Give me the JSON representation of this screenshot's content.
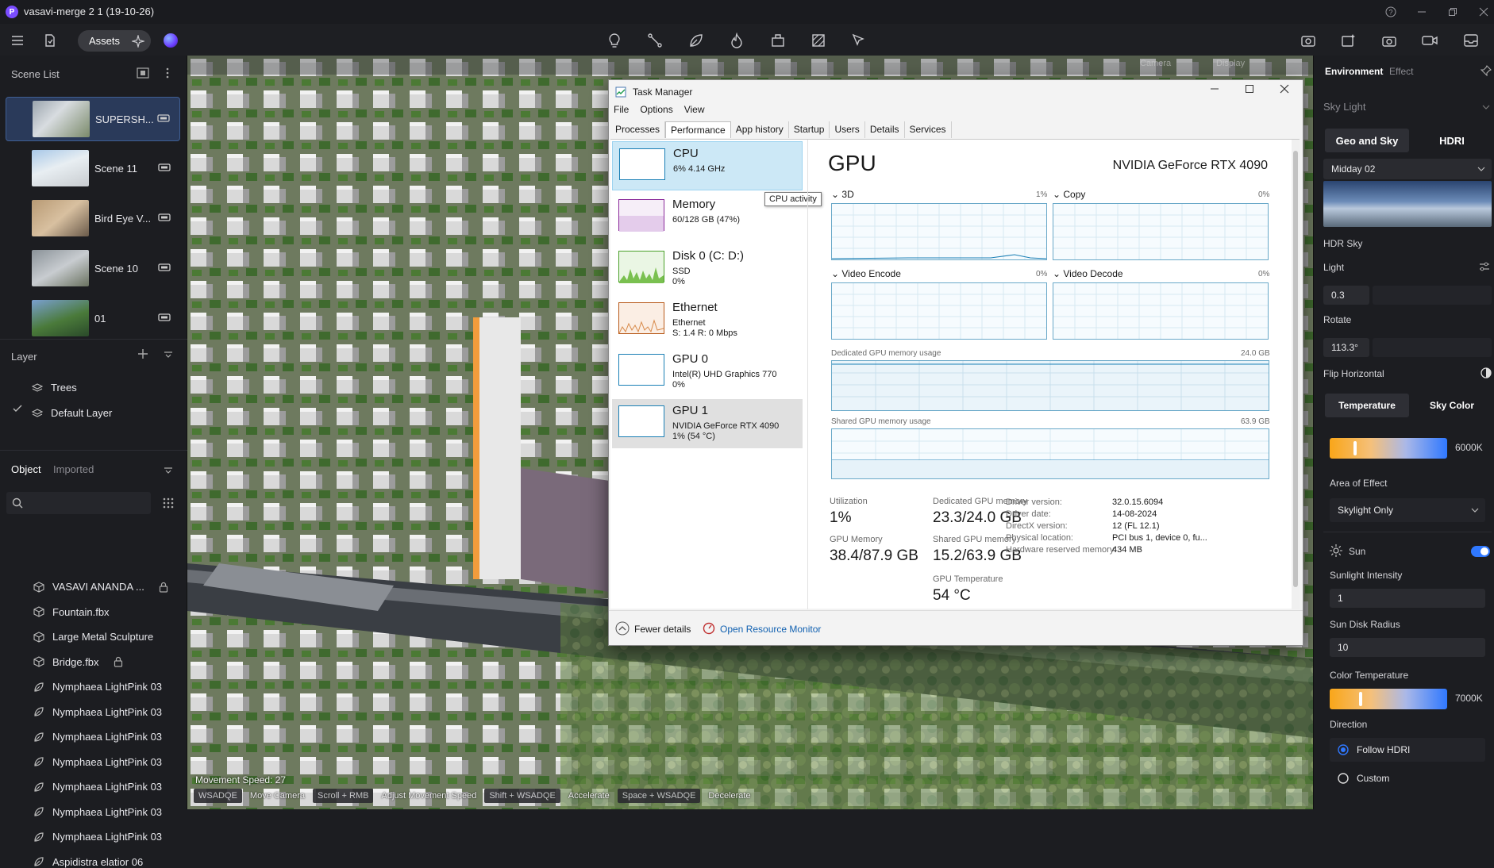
{
  "window": {
    "title": "vasavi-merge 2 1 (19-10-26)",
    "logo_letter": "P"
  },
  "toolbar": {
    "assets_label": "Assets"
  },
  "scene_list": {
    "title": "Scene List",
    "items": [
      {
        "name": "SUPERSH..."
      },
      {
        "name": "Scene 11"
      },
      {
        "name": "Bird Eye V..."
      },
      {
        "name": "Scene 10"
      },
      {
        "name": "01"
      }
    ]
  },
  "layer": {
    "title": "Layer",
    "items": [
      {
        "name": "Trees"
      },
      {
        "name": "Default Layer"
      }
    ]
  },
  "objects": {
    "tab_object": "Object",
    "tab_imported": "Imported",
    "items": [
      {
        "name": "VASAVI ANANDA ...",
        "locked": true
      },
      {
        "name": "Fountain.fbx"
      },
      {
        "name": "Large Metal Sculpture"
      },
      {
        "name": "Bridge.fbx",
        "locked": true
      },
      {
        "name": "Nymphaea LightPink 03"
      },
      {
        "name": "Nymphaea LightPink 03"
      },
      {
        "name": "Nymphaea LightPink 03"
      },
      {
        "name": "Nymphaea LightPink 03"
      },
      {
        "name": "Nymphaea LightPink 03"
      },
      {
        "name": "Nymphaea LightPink 03"
      },
      {
        "name": "Nymphaea LightPink 03"
      },
      {
        "name": "Aspidistra elatior 06"
      }
    ]
  },
  "viewport": {
    "overlay_camera": "Camera",
    "overlay_display": "Display",
    "movement_speed": "Movement Speed: 27",
    "hints": [
      {
        "key": "WSADQE",
        "desc": "Move Camera"
      },
      {
        "key": "Scroll + RMB",
        "desc": "Adjust Movement Speed"
      },
      {
        "key": "Shift + WSADQE",
        "desc": "Accelerate"
      },
      {
        "key": "Space + WSADQE",
        "desc": "Decelerate"
      }
    ]
  },
  "task_manager": {
    "title": "Task Manager",
    "menu": [
      "File",
      "Options",
      "View"
    ],
    "tabs": [
      "Processes",
      "Performance",
      "App history",
      "Startup",
      "Users",
      "Details",
      "Services"
    ],
    "active_tab": "Performance",
    "tooltip": "CPU activity",
    "resources": [
      {
        "name": "CPU",
        "sub1": "6% 4.14 GHz",
        "sub2": "",
        "sub3": ""
      },
      {
        "name": "Memory",
        "sub1": "60/128 GB (47%)",
        "sub2": "",
        "sub3": ""
      },
      {
        "name": "Disk 0 (C: D:)",
        "sub1": "SSD",
        "sub2": "0%",
        "sub3": ""
      },
      {
        "name": "Ethernet",
        "sub1": "Ethernet",
        "sub2": "S: 1.4 R: 0 Mbps",
        "sub3": ""
      },
      {
        "name": "GPU 0",
        "sub1": "Intel(R) UHD Graphics 770",
        "sub2": "0%",
        "sub3": ""
      },
      {
        "name": "GPU 1",
        "sub1": "NVIDIA GeForce RTX 4090",
        "sub2": "1% (54 °C)",
        "sub3": ""
      }
    ],
    "gpu": {
      "heading": "GPU",
      "model": "NVIDIA GeForce RTX 4090",
      "engines": [
        {
          "name": "3D",
          "pct": "1%"
        },
        {
          "name": "Copy",
          "pct": "0%"
        },
        {
          "name": "Video Encode",
          "pct": "0%"
        },
        {
          "name": "Video Decode",
          "pct": "0%"
        }
      ],
      "dedicated_label": "Dedicated GPU memory usage",
      "dedicated_max": "24.0 GB",
      "shared_label": "Shared GPU memory usage",
      "shared_max": "63.9 GB",
      "stats": {
        "utilization_label": "Utilization",
        "utilization": "1%",
        "gpu_memory_label": "GPU Memory",
        "gpu_memory": "38.4/87.9 GB",
        "dedicated_label": "Dedicated GPU memory",
        "dedicated": "23.3/24.0 GB",
        "shared_label": "Shared GPU memory",
        "shared": "15.2/63.9 GB",
        "temp_label": "GPU Temperature",
        "temp": "54 °C"
      },
      "driver": [
        {
          "k": "Driver version:",
          "v": "32.0.15.6094"
        },
        {
          "k": "Driver date:",
          "v": "14-08-2024"
        },
        {
          "k": "DirectX version:",
          "v": "12 (FL 12.1)"
        },
        {
          "k": "Physical location:",
          "v": "PCI bus 1, device 0, fu..."
        },
        {
          "k": "Hardware reserved memory:",
          "v": "434 MB"
        }
      ]
    },
    "footer": {
      "fewer": "Fewer details",
      "monitor": "Open Resource Monitor"
    }
  },
  "environment": {
    "tab_env": "Environment",
    "tab_effect": "Effect",
    "sky_light": "Sky Light",
    "geo_sky": "Geo and Sky",
    "hdri": "HDRI",
    "preset": "Midday 02",
    "hdr_sky": "HDR Sky",
    "light_label": "Light",
    "light_value": "0.3",
    "rotate_label": "Rotate",
    "rotate_value": "113.3°",
    "flip_label": "Flip Horizontal",
    "temperature_tab": "Temperature",
    "sky_color_tab": "Sky Color",
    "temp_value": "6000K",
    "temp_fraction": 0.2,
    "area_label": "Area of Effect",
    "area_value": "Skylight Only",
    "sun_label": "Sun",
    "sun_on": true,
    "sunlight_label": "Sunlight Intensity",
    "sunlight_value": "1",
    "disk_label": "Sun Disk Radius",
    "disk_value": "10",
    "color_temp_label": "Color Temperature",
    "color_temp_value": "7000K",
    "color_temp_fraction": 0.25,
    "direction_label": "Direction",
    "follow_hdri": "Follow HDRI",
    "custom": "Custom",
    "accent": "#2f78ff"
  }
}
